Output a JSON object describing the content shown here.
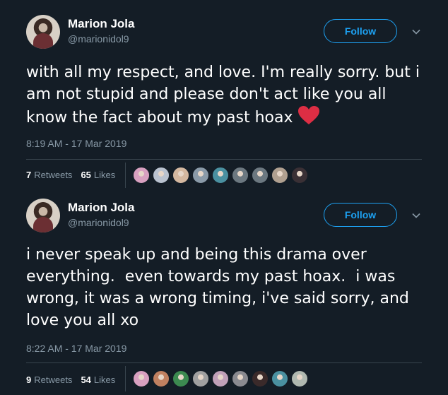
{
  "tweets": [
    {
      "author": {
        "name": "Marion Jola",
        "handle": "@marionidol9"
      },
      "follow_label": "Follow",
      "text": "with all my respect, and love. I'm really sorry. but i am not stupid and please don't act like you all know the fact about my past hoax",
      "timestamp": "8:19 AM - 17 Mar 2019",
      "retweets_count": "7",
      "retweets_label": "Retweets",
      "likes_count": "65",
      "likes_label": "Likes",
      "liker_colors": [
        "#d8a0c0",
        "#b9c2cf",
        "#d4b8a0",
        "#8a9aa8",
        "#4a90a0",
        "#6c7880",
        "#6c7880",
        "#b0a090",
        "#3a3035"
      ]
    },
    {
      "author": {
        "name": "Marion Jola",
        "handle": "@marionidol9"
      },
      "follow_label": "Follow",
      "text": "i never speak up and being this drama over everything.  even towards my past hoax.  i was wrong, it was a wrong timing, i've said sorry, and love you all xo",
      "timestamp": "8:22 AM - 17 Mar 2019",
      "retweets_count": "9",
      "retweets_label": "Retweets",
      "likes_count": "54",
      "likes_label": "Likes",
      "liker_colors": [
        "#d8a0c0",
        "#c08060",
        "#3c8a50",
        "#a0a0a0",
        "#c0a0b8",
        "#8a8a90",
        "#3a2a2a",
        "#4a90a0",
        "#b0b8b0"
      ]
    }
  ],
  "colors": {
    "background": "#141d26",
    "accent": "#1da1f2",
    "heart": "#e0245e",
    "muted": "#8899a6"
  },
  "icons": {
    "chevron": "chevron-down-icon",
    "heart": "red-heart-icon"
  }
}
